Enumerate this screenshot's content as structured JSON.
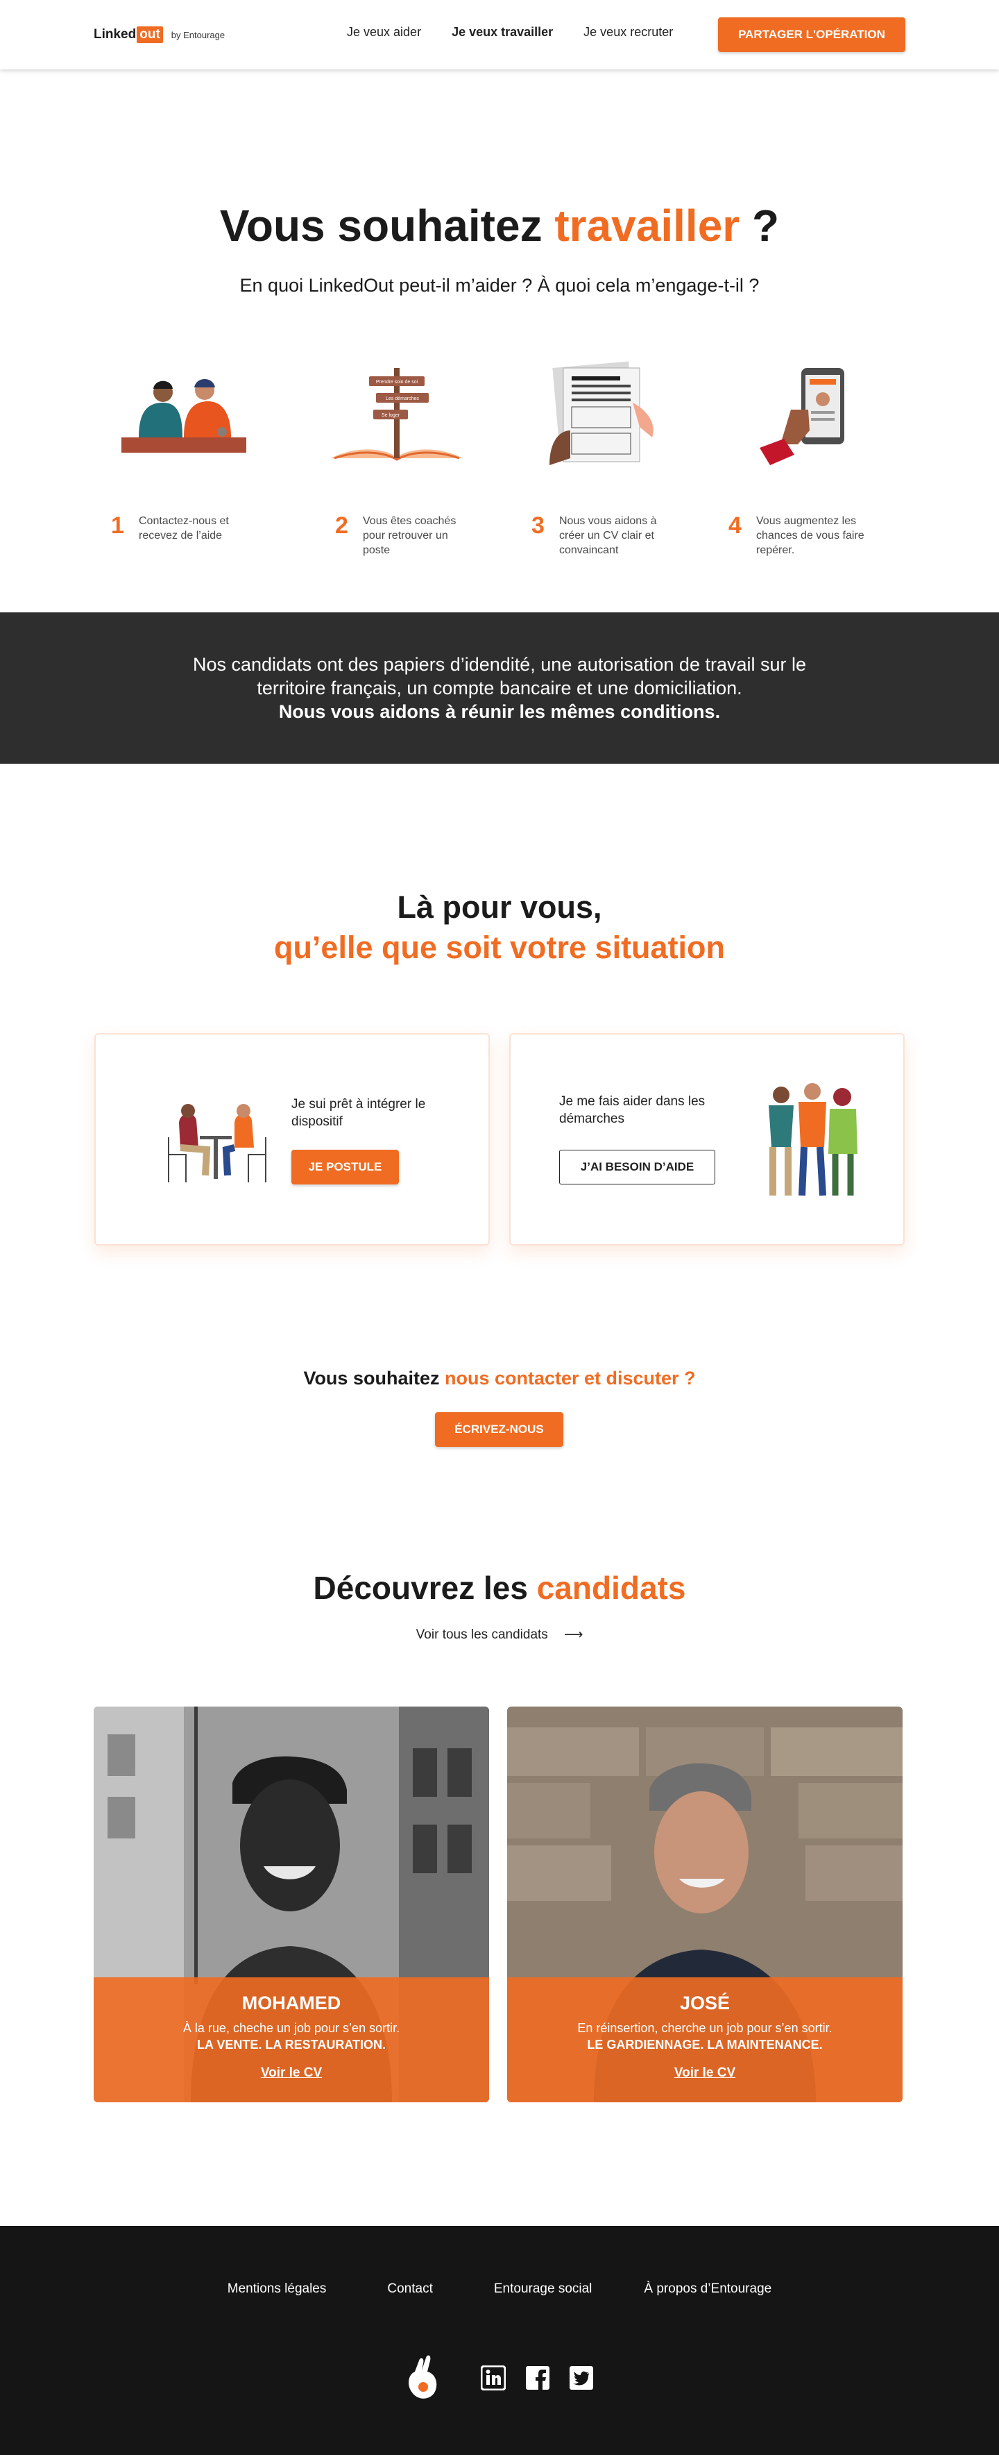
{
  "header": {
    "logo_linked": "Linked",
    "logo_out": "out",
    "logo_by": "by Entourage",
    "nav": [
      "Je veux aider",
      "Je veux travailler",
      "Je veux recruter"
    ],
    "share_button": "PARTAGER L'OPÉRATION"
  },
  "hero": {
    "title_pre": "Vous souhaitez ",
    "title_accent": "travailler",
    "title_post": " ?",
    "subtitle": "En quoi LinkedOut peut-il m’aider ? À quoi cela m’engage-t-il ?",
    "signpost": [
      "Prendre soin de soi",
      "Les démarches",
      "Se loger"
    ],
    "steps": [
      {
        "num": "1",
        "text": "Contactez-nous et recevez de l’aide"
      },
      {
        "num": "2",
        "text": "Vous êtes coachés pour retrouver un poste"
      },
      {
        "num": "3",
        "text": "Nous vous aidons à créer un CV clair et convaincant"
      },
      {
        "num": "4",
        "text": "Vous augmentez les chances de vous faire repérer."
      }
    ]
  },
  "band": {
    "line1": "Nos candidats ont des papiers d’idendité, une autorisation de travail sur le",
    "line2": "territoire français, un compte bancaire et une domiciliation.",
    "line3": "Nous vous aidons à réunir les mêmes conditions."
  },
  "situation": {
    "title_line1": "Là pour vous,",
    "title_line2": "qu’elle que soit votre situation",
    "card1": {
      "text": "Je sui prêt à intégrer le dispositif",
      "button": "JE POSTULE"
    },
    "card2": {
      "text": "Je me fais aider dans les démarches",
      "button": "J’AI BESOIN D’AIDE"
    }
  },
  "contact": {
    "pre": "Vous souhaitez ",
    "accent": "nous contacter et discuter ?",
    "button": "ÉCRIVEZ-NOUS"
  },
  "candidates": {
    "title_pre": "Découvrez les ",
    "title_accent": "candidats",
    "see_all": "Voir tous les candidats",
    "arrow": "⟶",
    "list": [
      {
        "name": "MOHAMED",
        "desc": "À la rue, cheche un job pour s’en sortir.",
        "skills": "LA VENTE. LA RESTAURATION.",
        "link": "Voir le CV"
      },
      {
        "name": "JOSÉ",
        "desc": "En réinsertion, cherche un job pour s’en sortir.",
        "skills": "LE GARDIENNAGE. LA MAINTENANCE.",
        "link": "Voir le CV"
      }
    ]
  },
  "footer": {
    "links": [
      "Mentions légales",
      "Contact",
      "Entourage social",
      "À propos d’Entourage"
    ],
    "social": [
      "linkedin-icon",
      "facebook-icon",
      "twitter-icon"
    ]
  },
  "colors": {
    "accent": "#f06c22",
    "dark_band": "#2e2e2e",
    "footer": "#151515"
  }
}
